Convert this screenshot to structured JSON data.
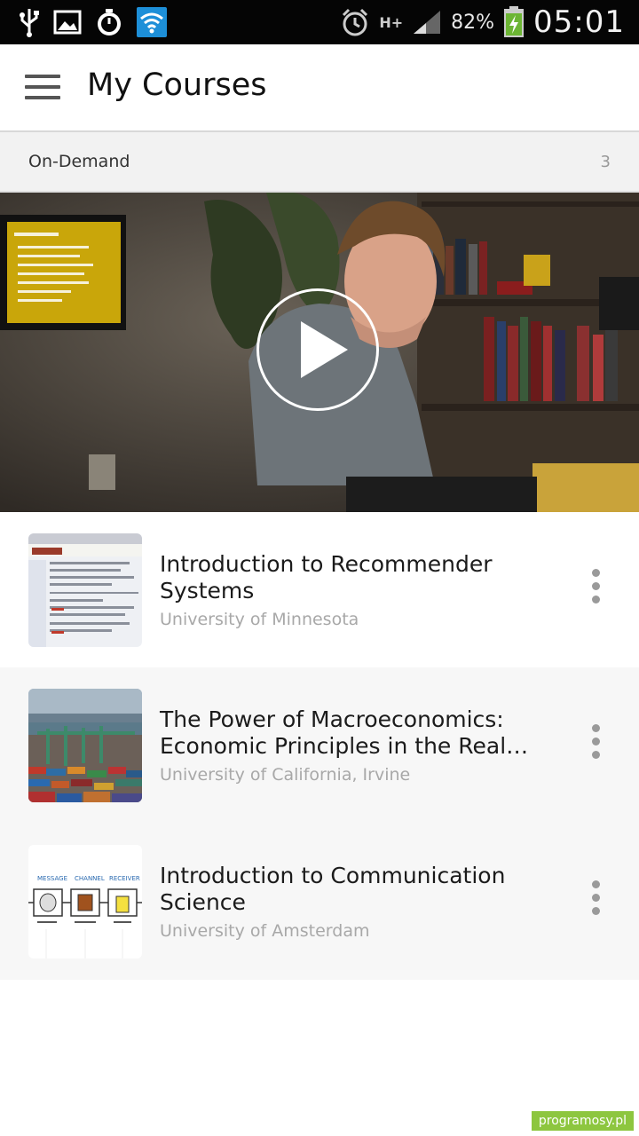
{
  "status_bar": {
    "battery_percent": "82%",
    "time": "05:01",
    "network": "H+"
  },
  "header": {
    "title": "My Courses"
  },
  "section": {
    "title": "On-Demand",
    "count": "3"
  },
  "courses": [
    {
      "title": "Introduction to Recommender Systems",
      "university": "University of Minnesota"
    },
    {
      "title": "The Power of Macroeconomics: Economic Principles in the Real…",
      "university": "University of California, Irvine"
    },
    {
      "title": "Introduction to Communication Science",
      "university": "University of Amsterdam"
    }
  ],
  "thumb3_labels": {
    "message": "MESSAGE",
    "channel": "CHANNEL",
    "receiver": "RECEIVER"
  },
  "watermark": "programosy.pl",
  "colors": {
    "statusbar": "#050505",
    "accent": "#8dc63f"
  }
}
